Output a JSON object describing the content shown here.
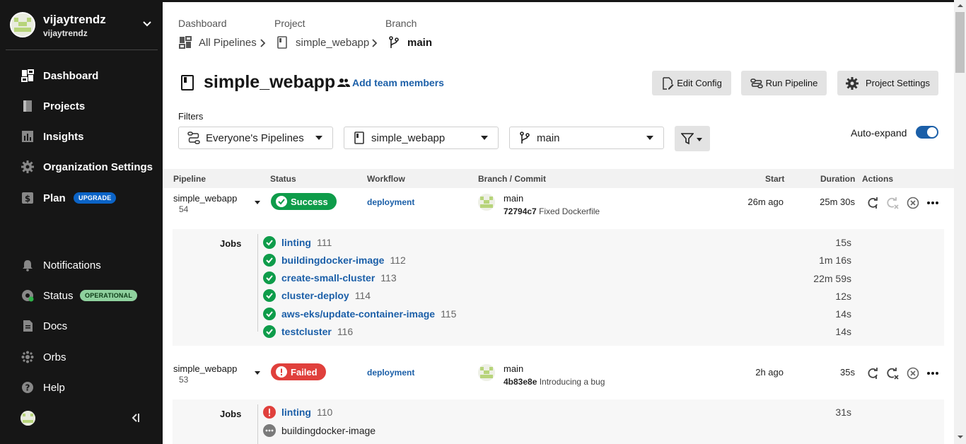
{
  "org": {
    "name": "vijaytrendz",
    "sub": "vijaytrendz"
  },
  "sidebar": {
    "items": [
      {
        "label": "Dashboard",
        "icon": "dashboard-icon"
      },
      {
        "label": "Projects",
        "icon": "projects-icon"
      },
      {
        "label": "Insights",
        "icon": "insights-icon"
      },
      {
        "label": "Organization Settings",
        "icon": "gear-icon"
      },
      {
        "label": "Plan",
        "icon": "dollar-icon",
        "badge": "UPGRADE"
      }
    ],
    "bottom": [
      {
        "label": "Notifications",
        "icon": "bell-icon"
      },
      {
        "label": "Status",
        "icon": "status-icon",
        "badge": "OPERATIONAL"
      },
      {
        "label": "Docs",
        "icon": "docs-icon"
      },
      {
        "label": "Orbs",
        "icon": "orbs-icon"
      },
      {
        "label": "Help",
        "icon": "help-icon"
      }
    ]
  },
  "breadcrumb": {
    "captions": [
      "Dashboard",
      "Project",
      "Branch"
    ],
    "items": [
      "All Pipelines",
      "simple_webapp",
      "main"
    ]
  },
  "header": {
    "title": "simple_webapp",
    "add_members": "Add team members",
    "buttons": [
      "Edit Config",
      "Run Pipeline",
      "Project Settings"
    ]
  },
  "filters": {
    "label": "Filters",
    "pipelines": "Everyone's Pipelines",
    "project": "simple_webapp",
    "branch": "main",
    "auto_expand": "Auto-expand",
    "auto_expand_on": true
  },
  "table": {
    "headers": [
      "Pipeline",
      "Status",
      "Workflow",
      "Branch / Commit",
      "Start",
      "Duration",
      "Actions"
    ]
  },
  "pipelines": [
    {
      "name": "simple_webapp",
      "number": "54",
      "status": "Success",
      "workflow": "deployment",
      "branch": "main",
      "commit_hash": "72794c7",
      "commit_msg": "Fixed Dockerfile",
      "start": "26m ago",
      "duration": "25m 30s",
      "jobs_label": "Jobs",
      "jobs": [
        {
          "name": "linting",
          "num": "111",
          "duration": "15s",
          "state": "success"
        },
        {
          "name": "buildingdocker-image",
          "num": "112",
          "duration": "1m 16s",
          "state": "success"
        },
        {
          "name": "create-small-cluster",
          "num": "113",
          "duration": "22m 59s",
          "state": "success"
        },
        {
          "name": "cluster-deploy",
          "num": "114",
          "duration": "12s",
          "state": "success"
        },
        {
          "name": "aws-eks/update-container-image",
          "num": "115",
          "duration": "14s",
          "state": "success"
        },
        {
          "name": "testcluster",
          "num": "116",
          "duration": "14s",
          "state": "success"
        }
      ]
    },
    {
      "name": "simple_webapp",
      "number": "53",
      "status": "Failed",
      "workflow": "deployment",
      "branch": "main",
      "commit_hash": "4b83e8e",
      "commit_msg": "Introducing a bug",
      "start": "2h ago",
      "duration": "35s",
      "jobs_label": "Jobs",
      "jobs": [
        {
          "name": "linting",
          "num": "110",
          "duration": "31s",
          "state": "failed"
        },
        {
          "name": "buildingdocker-image",
          "num": "",
          "duration": "",
          "state": "blocked"
        }
      ]
    }
  ],
  "colors": {
    "sidebar_bg": "#161616",
    "link": "#1b5fa8",
    "success": "#0e9c4a",
    "failed": "#e0403c"
  }
}
